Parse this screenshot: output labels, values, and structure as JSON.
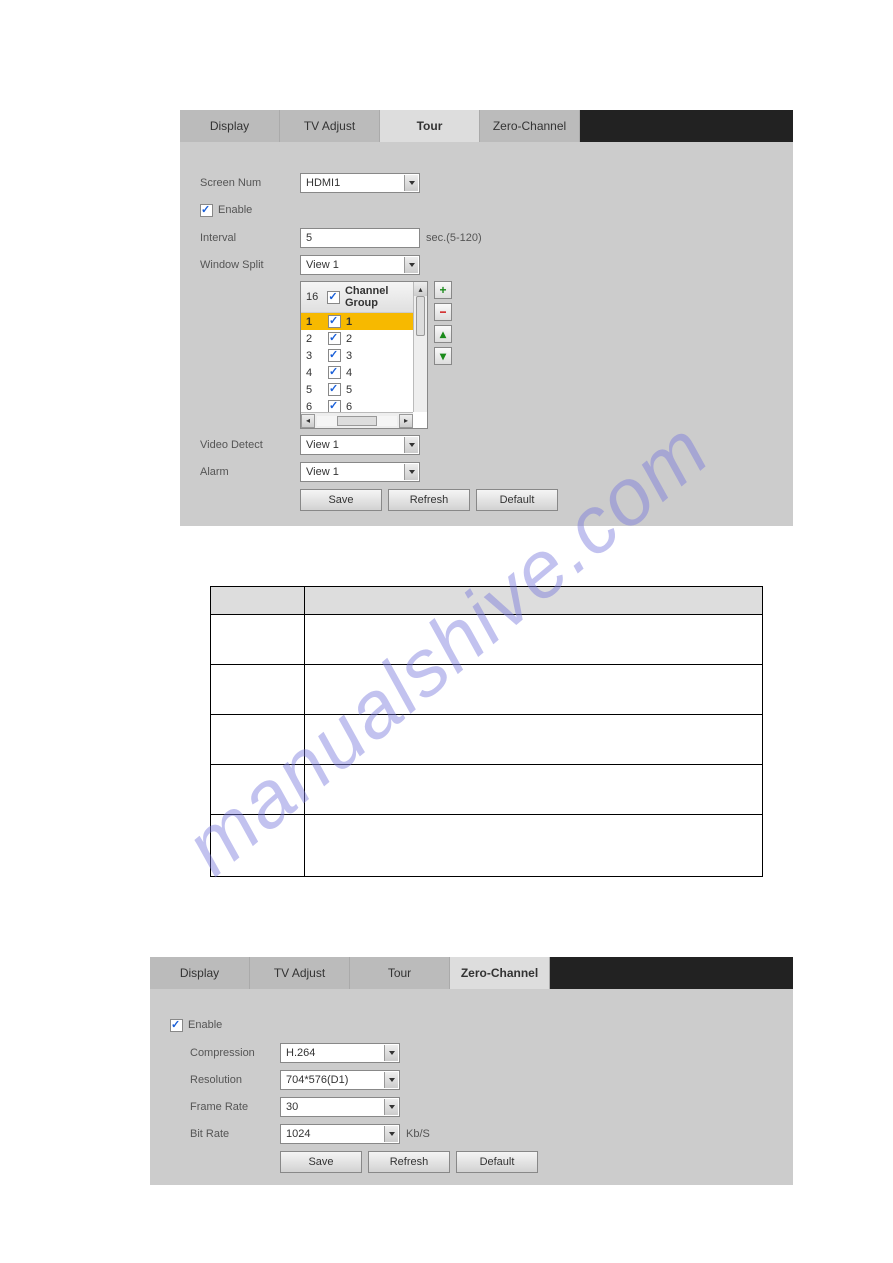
{
  "tabs": {
    "display": "Display",
    "tv_adjust": "TV Adjust",
    "tour": "Tour",
    "zero_channel": "Zero-Channel"
  },
  "tour": {
    "screen_num_label": "Screen Num",
    "screen_num_value": "HDMI1",
    "enable": "Enable",
    "interval_label": "Interval",
    "interval_value": "5",
    "interval_unit": "sec.(5-120)",
    "window_split_label": "Window Split",
    "window_split_value": "View 1",
    "list_header_num": "16",
    "list_header_label": "Channel Group",
    "rows": [
      {
        "n": "1",
        "v": "1",
        "selected": true
      },
      {
        "n": "2",
        "v": "2",
        "selected": false
      },
      {
        "n": "3",
        "v": "3",
        "selected": false
      },
      {
        "n": "4",
        "v": "4",
        "selected": false
      },
      {
        "n": "5",
        "v": "5",
        "selected": false
      },
      {
        "n": "6",
        "v": "6",
        "selected": false
      }
    ],
    "video_detect_label": "Video Detect",
    "video_detect_value": "View 1",
    "alarm_label": "Alarm",
    "alarm_value": "View 1"
  },
  "zero": {
    "enable": "Enable",
    "compression_label": "Compression",
    "compression_value": "H.264",
    "resolution_label": "Resolution",
    "resolution_value": "704*576(D1)",
    "frame_rate_label": "Frame Rate",
    "frame_rate_value": "30",
    "bit_rate_label": "Bit Rate",
    "bit_rate_value": "1024",
    "bit_rate_unit": "Kb/S"
  },
  "buttons": {
    "save": "Save",
    "refresh": "Refresh",
    "default": "Default"
  },
  "watermark": "manualshive.com"
}
